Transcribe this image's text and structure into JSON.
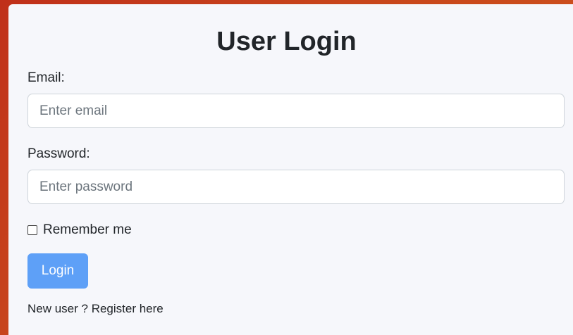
{
  "form": {
    "title": "User Login",
    "email": {
      "label": "Email:",
      "value": "",
      "placeholder": "Enter email"
    },
    "password": {
      "label": "Password:",
      "value": "",
      "placeholder": "Enter password"
    },
    "remember": {
      "label": "Remember me",
      "checked": false
    },
    "login_button": "Login",
    "register": {
      "prefix": "New user ? ",
      "link_text": "Register here"
    }
  },
  "colors": {
    "page_background": "#c8461c",
    "card_background": "#f6f7fb",
    "button_primary": "#5ea0f7"
  }
}
